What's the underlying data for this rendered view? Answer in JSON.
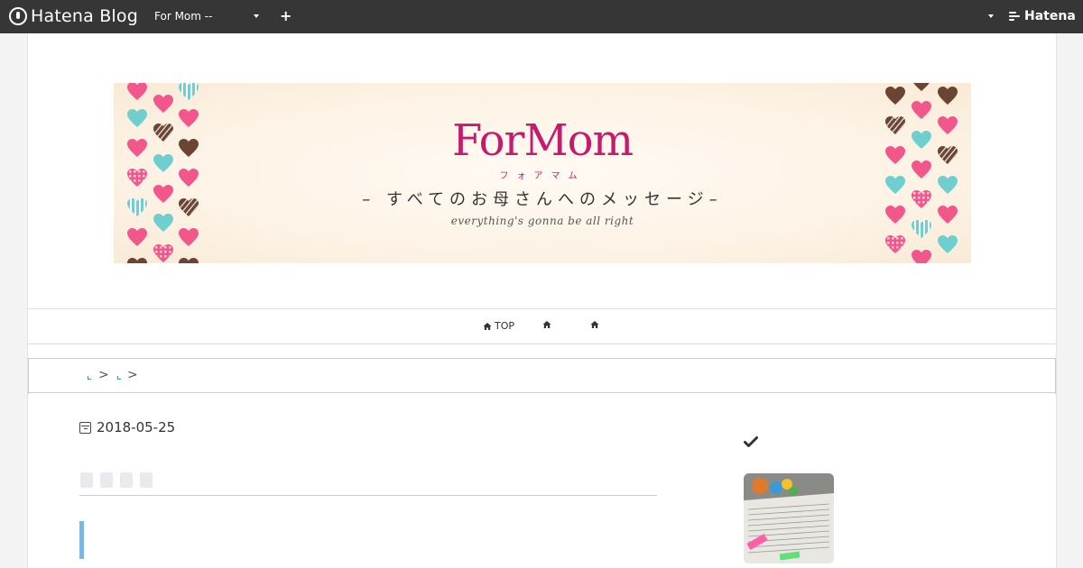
{
  "topbar": {
    "brand": "Hatena Blog",
    "blog_selector": "For Mom --",
    "add_label": "+",
    "right_brand": "Hatena"
  },
  "banner": {
    "title": "ForMom",
    "kana": "フォアマム",
    "subtitle": "– すべてのお母さんへのメッセージ–",
    "tagline": "everything's gonna be all right",
    "colors": {
      "title": "#c41c6c",
      "pink_heart": "#f2578b",
      "teal_heart": "#6fcfcf",
      "brown_heart": "#6b4433"
    }
  },
  "nav": {
    "items": [
      {
        "label": "TOP",
        "icon": "home-icon"
      },
      {
        "label": "",
        "icon": "home-icon"
      },
      {
        "label": "",
        "icon": "home-icon"
      }
    ]
  },
  "breadcrumb": {
    "separators": [
      ">",
      ">"
    ]
  },
  "article": {
    "date": "2018-05-25",
    "accent_color": "#7fb6e0"
  },
  "sidebar": {
    "icon": "check-icon"
  }
}
